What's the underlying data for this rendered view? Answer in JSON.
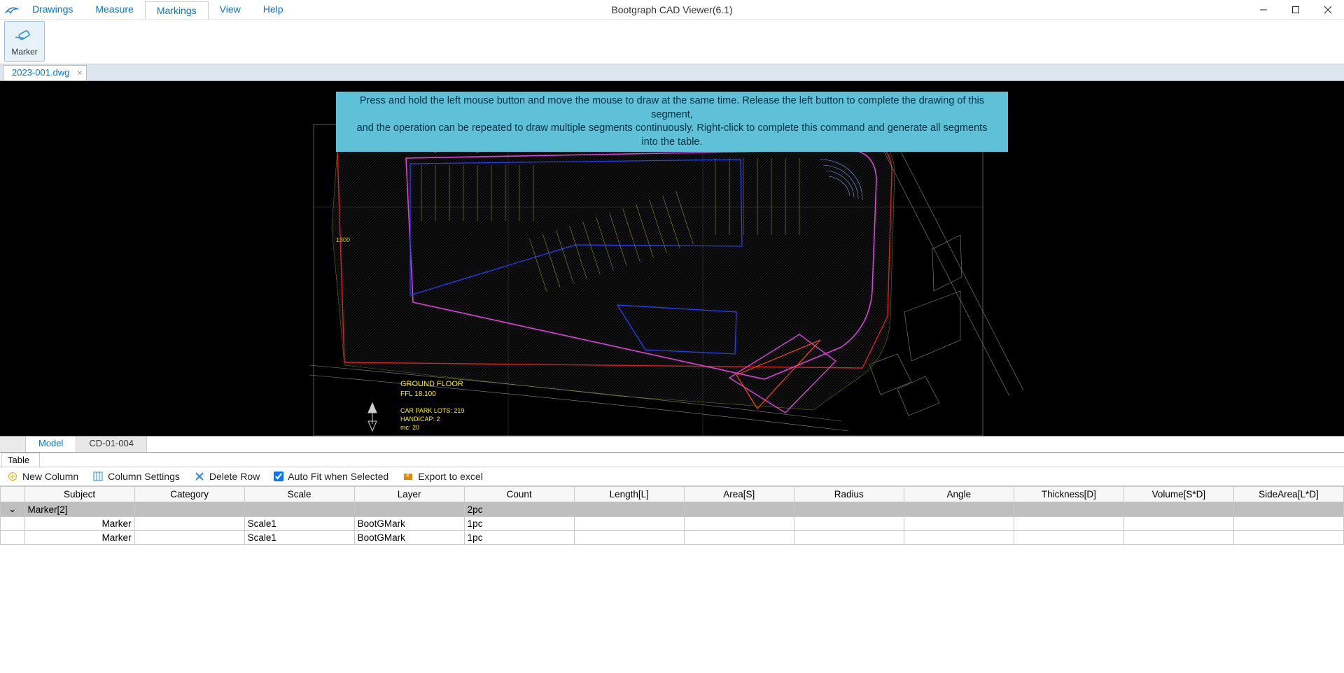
{
  "app_title": "Bootgraph CAD Viewer(6.1)",
  "menu": {
    "drawings": "Drawings",
    "measure": "Measure",
    "markings": "Markings",
    "view": "View",
    "help": "Help"
  },
  "ribbon": {
    "marker": "Marker"
  },
  "doc_tab": {
    "name": "2023-001.dwg",
    "close": "×"
  },
  "hint": {
    "line1": "Press and hold the left mouse button and move the mouse to draw at the same time. Release the left button to complete the drawing of this segment,",
    "line2": "and the operation can be repeated to draw multiple segments continuously. Right-click to complete this command and generate all segments into the table."
  },
  "drawing_text": {
    "title": "GROUND FLOOR",
    "ffl": "FFL 18.100",
    "lots": "CAR PARK LOTS:  219",
    "handicap": "HANDICAP:  2",
    "mc": "mc:   20",
    "dim1300": "1300"
  },
  "model_tabs": {
    "model": "Model",
    "sheet": "CD-01-004"
  },
  "table_panel": {
    "tab": "Table",
    "toolbar": {
      "new_column": "New Column",
      "column_settings": "Column Settings",
      "delete_row": "Delete Row",
      "autofit": "Auto Fit when Selected",
      "export": "Export to excel"
    },
    "columns": {
      "subject": "Subject",
      "category": "Category",
      "scale": "Scale",
      "layer": "Layer",
      "count": "Count",
      "length": "Length[L]",
      "area": "Area[S]",
      "radius": "Radius",
      "angle": "Angle",
      "thickness": "Thickness[D]",
      "volume": "Volume[S*D]",
      "sidearea": "SideArea[L*D]"
    },
    "group": {
      "name": "Marker[2]",
      "count": "2pc"
    },
    "rows": [
      {
        "subject": "Marker",
        "category": "",
        "scale": "Scale1",
        "layer": "BootGMark",
        "count": "1pc"
      },
      {
        "subject": "Marker",
        "category": "",
        "scale": "Scale1",
        "layer": "BootGMark",
        "count": "1pc"
      }
    ]
  }
}
